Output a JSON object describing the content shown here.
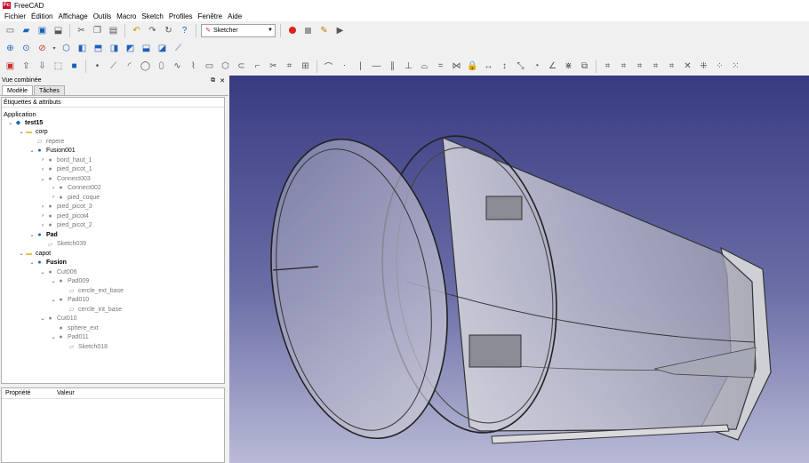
{
  "window": {
    "title": "FreeCAD",
    "logo": "Fc"
  },
  "menu": [
    "Fichier",
    "Édition",
    "Affichage",
    "Outils",
    "Macro",
    "Sketch",
    "Profiles",
    "Fenêtre",
    "Aide"
  ],
  "toolbar": {
    "workbench": "Sketcher",
    "icons_row1": [
      "new-file-icon",
      "open-file-icon",
      "save-icon",
      "save-as-icon",
      "cut-icon",
      "copy-icon",
      "paste-icon",
      "undo-icon",
      "redo-icon",
      "refresh-icon",
      "whats-this-icon"
    ],
    "icons_row2": [
      "fit-all-icon",
      "fit-selection-icon",
      "draw-style-icon",
      "isometric-view-icon",
      "front-view-icon",
      "top-view-icon",
      "right-view-icon",
      "rear-view-icon",
      "bottom-view-icon",
      "left-view-icon",
      "measure-icon"
    ],
    "icons_row3_count": 48
  },
  "combo_view": {
    "title": "Vue combinée",
    "tabs": [
      "Modèle",
      "Tâches"
    ],
    "labels_header": "Étiquettes & attributs",
    "application": "Application",
    "tree": [
      {
        "label": "test15",
        "level": 0,
        "toggle": "v",
        "icon": "doc",
        "bold": true
      },
      {
        "label": "corp",
        "level": 1,
        "toggle": "v",
        "icon": "folder"
      },
      {
        "label": "repere",
        "level": 2,
        "toggle": "",
        "icon": "sketch-dim",
        "dim": true
      },
      {
        "label": "Fusion001",
        "level": 2,
        "toggle": "v",
        "icon": "solid-blue"
      },
      {
        "label": "bord_haut_1",
        "level": 3,
        "toggle": ">",
        "icon": "solid-grey",
        "dim": true
      },
      {
        "label": "pied_picot_1",
        "level": 3,
        "toggle": ">",
        "icon": "solid-grey",
        "dim": true
      },
      {
        "label": "Connect003",
        "level": 3,
        "toggle": "v",
        "icon": "solid-grey",
        "dim": true
      },
      {
        "label": "Connect002",
        "level": 4,
        "toggle": ">",
        "icon": "solid-grey",
        "dim": true
      },
      {
        "label": "pied_coque",
        "level": 4,
        "toggle": ">",
        "icon": "solid-grey",
        "dim": true
      },
      {
        "label": "pied_picot_3",
        "level": 3,
        "toggle": ">",
        "icon": "solid-grey",
        "dim": true
      },
      {
        "label": "pied_picot4",
        "level": 3,
        "toggle": ">",
        "icon": "solid-grey",
        "dim": true
      },
      {
        "label": "pied_picot_2",
        "level": 3,
        "toggle": ">",
        "icon": "solid-grey",
        "dim": true
      },
      {
        "label": "Pad",
        "level": 2,
        "toggle": "v",
        "icon": "solid-blue",
        "bold": true
      },
      {
        "label": "Sketch039",
        "level": 3,
        "toggle": "",
        "icon": "sketch-dim",
        "dim": true
      },
      {
        "label": "capot",
        "level": 1,
        "toggle": "v",
        "icon": "folder"
      },
      {
        "label": "Fusion",
        "level": 2,
        "toggle": "v",
        "icon": "solid-blue",
        "bold": true
      },
      {
        "label": "Cut006",
        "level": 3,
        "toggle": "v",
        "icon": "solid-grey",
        "dim": true
      },
      {
        "label": "Pad009",
        "level": 4,
        "toggle": "v",
        "icon": "solid-grey",
        "dim": true
      },
      {
        "label": "cercle_ext_base",
        "level": 5,
        "toggle": "",
        "icon": "sketch-dim",
        "dim": true
      },
      {
        "label": "Pad010",
        "level": 4,
        "toggle": "v",
        "icon": "solid-grey",
        "dim": true
      },
      {
        "label": "cercle_int_base",
        "level": 5,
        "toggle": "",
        "icon": "sketch-dim",
        "dim": true
      },
      {
        "label": "Cut010",
        "level": 3,
        "toggle": "v",
        "icon": "solid-grey",
        "dim": true
      },
      {
        "label": "sphere_ext",
        "level": 4,
        "toggle": "",
        "icon": "sphere",
        "dim": true
      },
      {
        "label": "Pad011",
        "level": 4,
        "toggle": "v",
        "icon": "solid-grey",
        "dim": true
      },
      {
        "label": "Sketch018",
        "level": 5,
        "toggle": "",
        "icon": "sketch-dim",
        "dim": true
      }
    ],
    "properties": {
      "col_property": "Propriété",
      "col_value": "Valeur"
    }
  },
  "colors": {
    "view_top": "#393b82",
    "view_bottom": "#b9bad6",
    "accent_blue": "#1c5fb8"
  }
}
